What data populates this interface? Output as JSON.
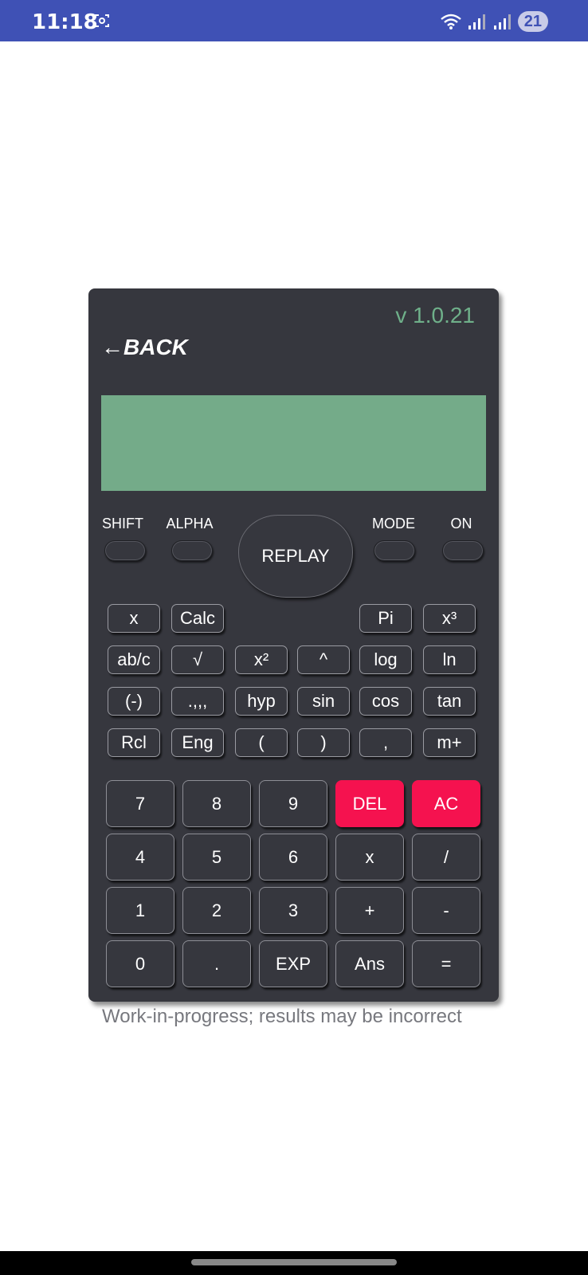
{
  "status_bar": {
    "time": "11:18",
    "badge": "21",
    "background": "#3f51b5",
    "icons": [
      "screenshot-icon",
      "wifi-icon",
      "signal-icon",
      "signal-icon"
    ]
  },
  "header": {
    "version": "v 1.0.21",
    "back_arrow": "←",
    "back_label": "BACK"
  },
  "function_row": {
    "shift": "SHIFT",
    "alpha": "ALPHA",
    "replay": "REPLAY",
    "mode": "MODE",
    "on": "ON"
  },
  "small_keys": [
    [
      "x",
      "Calc",
      "",
      "",
      "Pi",
      "x³"
    ],
    [
      "ab/c",
      "√",
      "x²",
      "^",
      "log",
      "ln"
    ],
    [
      "(-)",
      ".,,,",
      "hyp",
      "sin",
      "cos",
      "tan"
    ],
    [
      "Rcl",
      "Eng",
      "(",
      ")",
      ",",
      "m+"
    ]
  ],
  "big_keys": [
    [
      "7",
      "8",
      "9",
      "DEL",
      "AC"
    ],
    [
      "4",
      "5",
      "6",
      "x",
      "/"
    ],
    [
      "1",
      "2",
      "3",
      "+",
      "-"
    ],
    [
      "0",
      ".",
      "EXP",
      "Ans",
      "="
    ]
  ],
  "note": "Work-in-progress; results may be incorrect",
  "colors": {
    "body": "#36373e",
    "display": "#74ab89",
    "version": "#6fb08a",
    "red_key": "#f5124f"
  }
}
